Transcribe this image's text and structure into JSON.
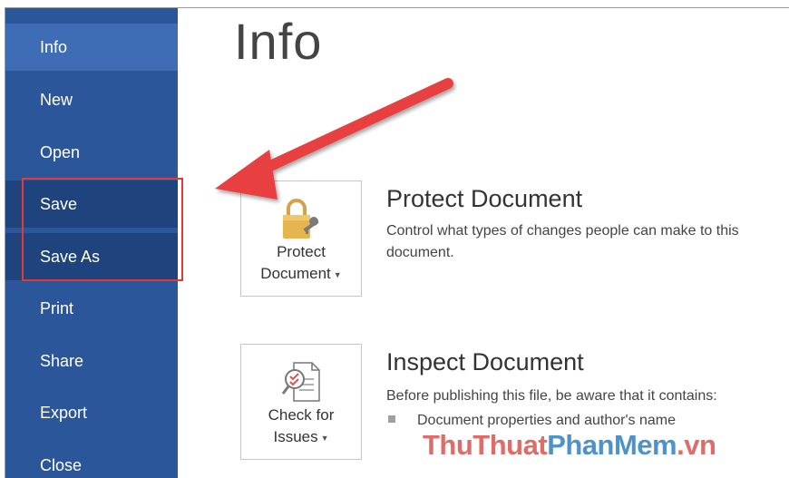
{
  "sidebar": {
    "items": [
      {
        "label": "Info"
      },
      {
        "label": "New"
      },
      {
        "label": "Open"
      },
      {
        "label": "Save"
      },
      {
        "label": "Save As"
      },
      {
        "label": "Print"
      },
      {
        "label": "Share"
      },
      {
        "label": "Export"
      },
      {
        "label": "Close"
      }
    ],
    "active": "Info"
  },
  "main": {
    "title": "Info",
    "sections": [
      {
        "button": {
          "line1": "Protect",
          "line2": "Document",
          "icon": "lock-key-icon"
        },
        "title": "Protect Document",
        "description": "Control what types of changes people can make to this document."
      },
      {
        "button": {
          "line1": "Check for",
          "line2": "Issues",
          "icon": "inspect-document-icon"
        },
        "title": "Inspect Document",
        "description": "Before publishing this file, be aware that it contains:",
        "bullets": [
          "Document properties and author's name"
        ]
      }
    ]
  },
  "colors": {
    "sidebar": "#2b579a",
    "sidebar_active": "#3e6db5",
    "highlight": "#e53935",
    "arrow": "#e53935"
  },
  "watermark": {
    "part1": "ThuThuat",
    "part2": "PhanMem",
    "part3": ".vn"
  }
}
